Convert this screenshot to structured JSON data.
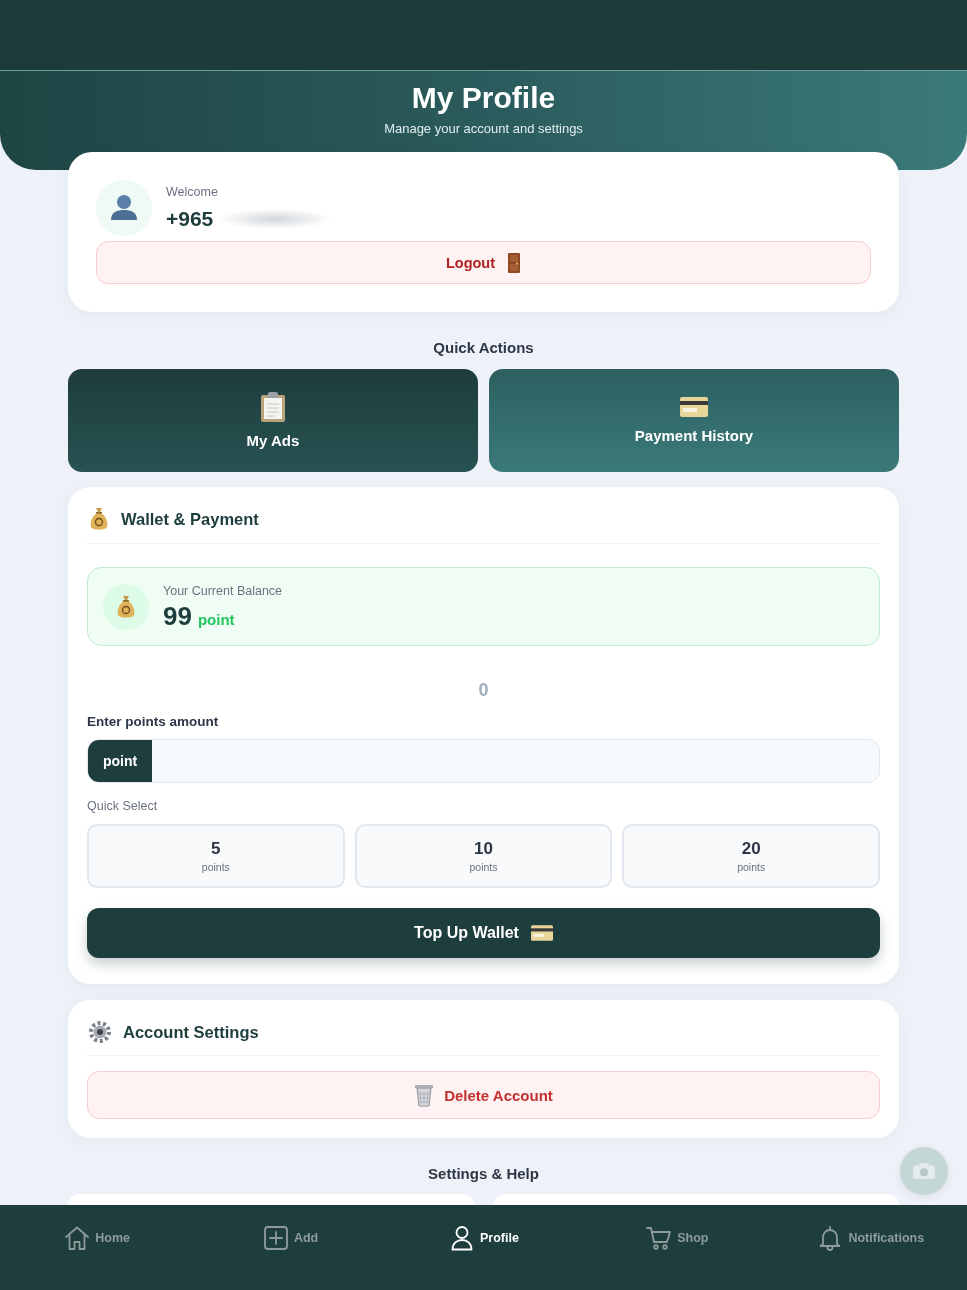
{
  "header": {
    "title": "My Profile",
    "subtitle": "Manage your account and settings"
  },
  "profile": {
    "greeting": "Welcome",
    "phone": "+965",
    "logout_button": "Logout"
  },
  "quick_actions": {
    "title": "Quick Actions",
    "items": [
      {
        "kind": "ads",
        "label": "My Ads"
      },
      {
        "kind": "payments",
        "label": "Payment History"
      }
    ]
  },
  "wallet": {
    "title": "Wallet & Payment",
    "balance_label": "Your Current Balance",
    "balance": "99",
    "balance_unit": "point",
    "amount_display": "0",
    "amount_label": "Enter points amount",
    "input_prefix": "point",
    "quick_select_label": "Quick Select",
    "quick_select": [
      {
        "value": "5",
        "unit": "points",
        "selected": false
      },
      {
        "value": "10",
        "unit": "points",
        "selected": false
      },
      {
        "value": "20",
        "unit": "points",
        "selected": false
      }
    ],
    "top_up_button": "Top Up Wallet"
  },
  "account_settings": {
    "title": "Account Settings",
    "delete_button": "Delete Account"
  },
  "settings_help": {
    "title": "Settings & Help"
  },
  "bottom_nav": [
    {
      "kind": "home",
      "label": "Home",
      "selected": false
    },
    {
      "kind": "add",
      "label": "Add",
      "selected": false
    },
    {
      "kind": "profile",
      "label": "Profile",
      "selected": true
    },
    {
      "kind": "shop",
      "label": "Shop",
      "selected": false
    },
    {
      "kind": "notifications",
      "label": "Notifications",
      "selected": false
    }
  ]
}
